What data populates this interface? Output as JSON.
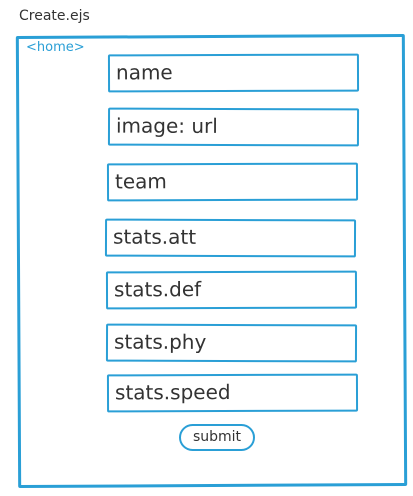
{
  "page": {
    "title": "Create.ejs"
  },
  "nav": {
    "home_label": "<home>"
  },
  "form": {
    "fields": [
      {
        "label": "name"
      },
      {
        "label": "image: url"
      },
      {
        "label": "team"
      },
      {
        "label": "stats.att"
      },
      {
        "label": "stats.def"
      },
      {
        "label": "stats.phy"
      },
      {
        "label": "stats.speed"
      }
    ],
    "submit_label": "submit"
  },
  "colors": {
    "accent": "#2a9fd6",
    "text": "#333333"
  }
}
